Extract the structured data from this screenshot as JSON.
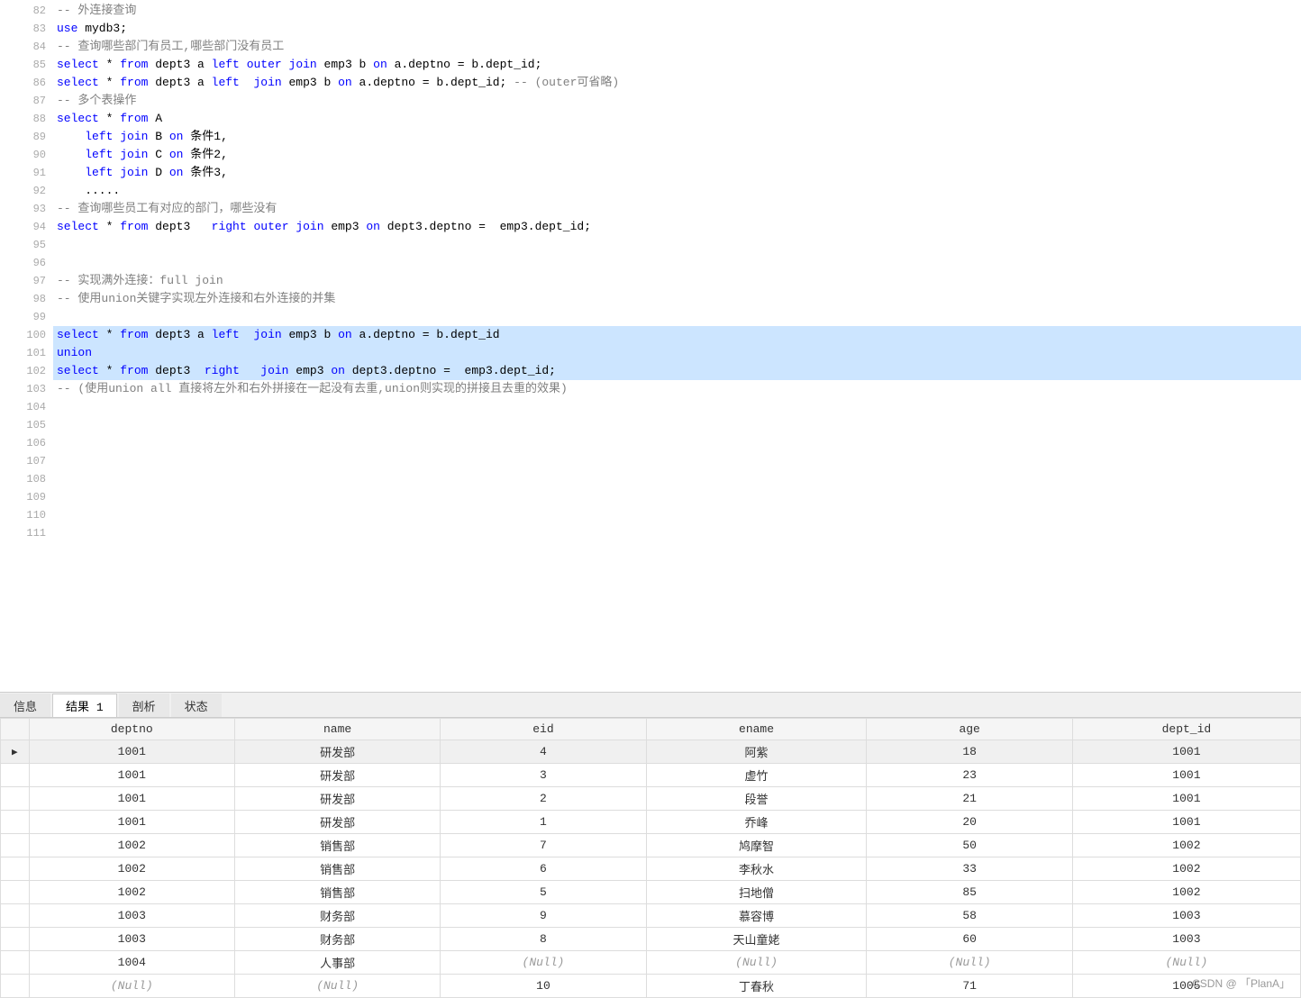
{
  "editor": {
    "lines": [
      {
        "num": 82,
        "highlighted": false,
        "content": [
          {
            "type": "comment",
            "text": "-- 外连接查询"
          }
        ]
      },
      {
        "num": 83,
        "highlighted": false,
        "content": [
          {
            "type": "kw",
            "text": "use"
          },
          {
            "type": "text",
            "text": " mydb3;"
          }
        ]
      },
      {
        "num": 84,
        "highlighted": false,
        "content": [
          {
            "type": "comment",
            "text": "-- 查询哪些部门有员工,哪些部门没有员工"
          }
        ]
      },
      {
        "num": 85,
        "highlighted": false,
        "content": [
          {
            "type": "kw",
            "text": "select"
          },
          {
            "type": "text",
            "text": " * "
          },
          {
            "type": "kw",
            "text": "from"
          },
          {
            "type": "text",
            "text": " dept3 a "
          },
          {
            "type": "kw",
            "text": "left"
          },
          {
            "type": "text",
            "text": " "
          },
          {
            "type": "kw",
            "text": "outer"
          },
          {
            "type": "text",
            "text": " "
          },
          {
            "type": "kw",
            "text": "join"
          },
          {
            "type": "text",
            "text": " emp3 b "
          },
          {
            "type": "kw",
            "text": "on"
          },
          {
            "type": "text",
            "text": " a.deptno = b.dept_id;"
          }
        ]
      },
      {
        "num": 86,
        "highlighted": false,
        "content": [
          {
            "type": "kw",
            "text": "select"
          },
          {
            "type": "text",
            "text": " * "
          },
          {
            "type": "kw",
            "text": "from"
          },
          {
            "type": "text",
            "text": " dept3 a "
          },
          {
            "type": "kw",
            "text": "left"
          },
          {
            "type": "text",
            "text": "  "
          },
          {
            "type": "kw",
            "text": "join"
          },
          {
            "type": "text",
            "text": " emp3 b "
          },
          {
            "type": "kw",
            "text": "on"
          },
          {
            "type": "text",
            "text": " a.deptno = b.dept_id; "
          },
          {
            "type": "comment",
            "text": "-- (outer可省略)"
          }
        ]
      },
      {
        "num": 87,
        "highlighted": false,
        "content": [
          {
            "type": "comment",
            "text": "-- 多个表操作"
          }
        ]
      },
      {
        "num": 88,
        "highlighted": false,
        "content": [
          {
            "type": "kw",
            "text": "select"
          },
          {
            "type": "text",
            "text": " * "
          },
          {
            "type": "kw",
            "text": "from"
          },
          {
            "type": "text",
            "text": " A"
          }
        ]
      },
      {
        "num": 89,
        "highlighted": false,
        "content": [
          {
            "type": "text",
            "text": "    "
          },
          {
            "type": "kw",
            "text": "left"
          },
          {
            "type": "text",
            "text": " "
          },
          {
            "type": "kw",
            "text": "join"
          },
          {
            "type": "text",
            "text": " B "
          },
          {
            "type": "kw",
            "text": "on"
          },
          {
            "type": "text",
            "text": " 条件1,"
          }
        ]
      },
      {
        "num": 90,
        "highlighted": false,
        "content": [
          {
            "type": "text",
            "text": "    "
          },
          {
            "type": "kw",
            "text": "left"
          },
          {
            "type": "text",
            "text": " "
          },
          {
            "type": "kw",
            "text": "join"
          },
          {
            "type": "text",
            "text": " C "
          },
          {
            "type": "kw",
            "text": "on"
          },
          {
            "type": "text",
            "text": " 条件2,"
          }
        ]
      },
      {
        "num": 91,
        "highlighted": false,
        "content": [
          {
            "type": "text",
            "text": "    "
          },
          {
            "type": "kw",
            "text": "left"
          },
          {
            "type": "text",
            "text": " "
          },
          {
            "type": "kw",
            "text": "join"
          },
          {
            "type": "text",
            "text": " D "
          },
          {
            "type": "kw",
            "text": "on"
          },
          {
            "type": "text",
            "text": " 条件3,"
          }
        ]
      },
      {
        "num": 92,
        "highlighted": false,
        "content": [
          {
            "type": "text",
            "text": "    ....."
          }
        ]
      },
      {
        "num": 93,
        "highlighted": false,
        "content": [
          {
            "type": "comment",
            "text": "-- 查询哪些员工有对应的部门，哪些没有"
          }
        ]
      },
      {
        "num": 94,
        "highlighted": false,
        "content": [
          {
            "type": "kw",
            "text": "select"
          },
          {
            "type": "text",
            "text": " * "
          },
          {
            "type": "kw",
            "text": "from"
          },
          {
            "type": "text",
            "text": " dept3   "
          },
          {
            "type": "kw",
            "text": "right"
          },
          {
            "type": "text",
            "text": " "
          },
          {
            "type": "kw",
            "text": "outer"
          },
          {
            "type": "text",
            "text": " "
          },
          {
            "type": "kw",
            "text": "join"
          },
          {
            "type": "text",
            "text": " emp3 "
          },
          {
            "type": "kw",
            "text": "on"
          },
          {
            "type": "text",
            "text": " dept3.deptno =  emp3.dept_id;"
          }
        ]
      },
      {
        "num": 95,
        "highlighted": false,
        "content": []
      },
      {
        "num": 96,
        "highlighted": false,
        "content": []
      },
      {
        "num": 97,
        "highlighted": false,
        "content": [
          {
            "type": "comment",
            "text": "-- 实现满外连接：full join"
          }
        ]
      },
      {
        "num": 98,
        "highlighted": false,
        "content": [
          {
            "type": "comment",
            "text": "-- 使用union关键字实现左外连接和右外连接的并集"
          }
        ]
      },
      {
        "num": 99,
        "highlighted": false,
        "content": []
      },
      {
        "num": 100,
        "highlighted": true,
        "content": [
          {
            "type": "kw",
            "text": "select"
          },
          {
            "type": "text",
            "text": " * "
          },
          {
            "type": "kw",
            "text": "from"
          },
          {
            "type": "text",
            "text": " dept3 a "
          },
          {
            "type": "kw",
            "text": "left"
          },
          {
            "type": "text",
            "text": "  "
          },
          {
            "type": "kw",
            "text": "join"
          },
          {
            "type": "text",
            "text": " emp3 b "
          },
          {
            "type": "kw",
            "text": "on"
          },
          {
            "type": "text",
            "text": " a.deptno = b.dept_id"
          }
        ]
      },
      {
        "num": 101,
        "highlighted": true,
        "content": [
          {
            "type": "kw",
            "text": "union"
          }
        ]
      },
      {
        "num": 102,
        "highlighted": true,
        "content": [
          {
            "type": "kw",
            "text": "select"
          },
          {
            "type": "text",
            "text": " * "
          },
          {
            "type": "kw",
            "text": "from"
          },
          {
            "type": "text",
            "text": " dept3  "
          },
          {
            "type": "kw",
            "text": "right"
          },
          {
            "type": "text",
            "text": "   "
          },
          {
            "type": "kw",
            "text": "join"
          },
          {
            "type": "text",
            "text": " emp3 "
          },
          {
            "type": "kw",
            "text": "on"
          },
          {
            "type": "text",
            "text": " dept3.deptno =  emp3.dept_id;"
          }
        ]
      },
      {
        "num": 103,
        "highlighted": false,
        "content": [
          {
            "type": "comment",
            "text": "-- (使用union all 直接将左外和右外拼接在一起没有去重,union则实现的拼接且去重的效果)"
          }
        ]
      },
      {
        "num": 104,
        "highlighted": false,
        "content": []
      },
      {
        "num": 105,
        "highlighted": false,
        "content": []
      },
      {
        "num": 106,
        "highlighted": false,
        "content": []
      },
      {
        "num": 107,
        "highlighted": false,
        "content": []
      },
      {
        "num": 108,
        "highlighted": false,
        "content": []
      },
      {
        "num": 109,
        "highlighted": false,
        "content": []
      },
      {
        "num": 110,
        "highlighted": false,
        "content": []
      },
      {
        "num": 111,
        "highlighted": false,
        "content": []
      }
    ]
  },
  "tabs": [
    {
      "label": "信息",
      "active": false
    },
    {
      "label": "结果 1",
      "active": true
    },
    {
      "label": "剖析",
      "active": false
    },
    {
      "label": "状态",
      "active": false
    }
  ],
  "table": {
    "columns": [
      "deptno",
      "name",
      "eid",
      "ename",
      "age",
      "dept_id"
    ],
    "rows": [
      {
        "indicator": "▶",
        "deptno": "1001",
        "name": "研发部",
        "eid": "4",
        "ename": "阿紫",
        "age": "18",
        "dept_id": "1001",
        "selected": true
      },
      {
        "indicator": "",
        "deptno": "1001",
        "name": "研发部",
        "eid": "3",
        "ename": "虚竹",
        "age": "23",
        "dept_id": "1001",
        "selected": false
      },
      {
        "indicator": "",
        "deptno": "1001",
        "name": "研发部",
        "eid": "2",
        "ename": "段誉",
        "age": "21",
        "dept_id": "1001",
        "selected": false
      },
      {
        "indicator": "",
        "deptno": "1001",
        "name": "研发部",
        "eid": "1",
        "ename": "乔峰",
        "age": "20",
        "dept_id": "1001",
        "selected": false
      },
      {
        "indicator": "",
        "deptno": "1002",
        "name": "销售部",
        "eid": "7",
        "ename": "鸠摩智",
        "age": "50",
        "dept_id": "1002",
        "selected": false
      },
      {
        "indicator": "",
        "deptno": "1002",
        "name": "销售部",
        "eid": "6",
        "ename": "李秋水",
        "age": "33",
        "dept_id": "1002",
        "selected": false
      },
      {
        "indicator": "",
        "deptno": "1002",
        "name": "销售部",
        "eid": "5",
        "ename": "扫地僧",
        "age": "85",
        "dept_id": "1002",
        "selected": false
      },
      {
        "indicator": "",
        "deptno": "1003",
        "name": "财务部",
        "eid": "9",
        "ename": "慕容博",
        "age": "58",
        "dept_id": "1003",
        "selected": false
      },
      {
        "indicator": "",
        "deptno": "1003",
        "name": "财务部",
        "eid": "8",
        "ename": "天山童姥",
        "age": "60",
        "dept_id": "1003",
        "selected": false
      },
      {
        "indicator": "",
        "deptno": "1004",
        "name": "人事部",
        "eid": "(Null)",
        "ename": "(Null)",
        "age": "(Null)",
        "dept_id": "(Null)",
        "selected": false
      },
      {
        "indicator": "",
        "deptno": "(Null)",
        "name": "(Null)",
        "eid": "10",
        "ename": "丁春秋",
        "age": "71",
        "dept_id": "1005",
        "selected": false
      }
    ]
  },
  "watermark": "CSDN @ 「PlanA」"
}
